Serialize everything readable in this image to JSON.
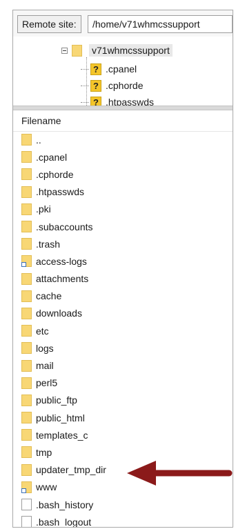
{
  "remote_site": {
    "label": "Remote site:",
    "path": "/home/v71whmcssupport"
  },
  "tree": {
    "root": "v71whmcssupport",
    "children": [
      ".cpanel",
      ".cphorde",
      ".htpasswds"
    ]
  },
  "file_list": {
    "column_header": "Filename",
    "rows": [
      {
        "name": "..",
        "type": "folder"
      },
      {
        "name": ".cpanel",
        "type": "folder"
      },
      {
        "name": ".cphorde",
        "type": "folder"
      },
      {
        "name": ".htpasswds",
        "type": "folder"
      },
      {
        "name": ".pki",
        "type": "folder"
      },
      {
        "name": ".subaccounts",
        "type": "folder"
      },
      {
        "name": ".trash",
        "type": "folder"
      },
      {
        "name": "access-logs",
        "type": "folder-link"
      },
      {
        "name": "attachments",
        "type": "folder"
      },
      {
        "name": "cache",
        "type": "folder"
      },
      {
        "name": "downloads",
        "type": "folder"
      },
      {
        "name": "etc",
        "type": "folder"
      },
      {
        "name": "logs",
        "type": "folder"
      },
      {
        "name": "mail",
        "type": "folder"
      },
      {
        "name": "perl5",
        "type": "folder"
      },
      {
        "name": "public_ftp",
        "type": "folder"
      },
      {
        "name": "public_html",
        "type": "folder"
      },
      {
        "name": "templates_c",
        "type": "folder"
      },
      {
        "name": "tmp",
        "type": "folder"
      },
      {
        "name": "updater_tmp_dir",
        "type": "folder"
      },
      {
        "name": "www",
        "type": "folder-link"
      },
      {
        "name": ".bash_history",
        "type": "file"
      },
      {
        "name": ".bash_logout",
        "type": "file"
      }
    ]
  },
  "colors": {
    "folder": "#f8d775",
    "arrow": "#8b1a1a",
    "unknown_icon": "#f4c52a"
  }
}
